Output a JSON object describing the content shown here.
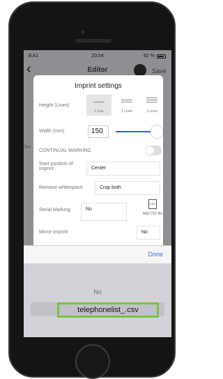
{
  "status": {
    "carrier": "ıll A1",
    "time": "20:54",
    "battery": "82 %"
  },
  "nav": {
    "title": "Editor",
    "save": "Save",
    "back_icon": "chevron-left-icon",
    "side_tab": "Set"
  },
  "dialog": {
    "title": "Imprint settings",
    "height_label": "Height (Lines)",
    "height_options": [
      "1 Line",
      "2 Lines",
      "3 Lines"
    ],
    "width_label": "Width (mm)",
    "width_value": "150",
    "continual_label": "CONTINUAL MARKING",
    "start_label": "Start position of imprint",
    "start_value": "Center",
    "whitespace_label": "Remove whitespace",
    "whitespace_value": "Crop both",
    "serial_label": "Serial Marking",
    "serial_value": "No",
    "csv_label": "Add CSV file",
    "csv_icon_text": "CSV",
    "mirror_label": "Mirror imprint",
    "mirror_value": "No"
  },
  "picker": {
    "done": "Done",
    "options": [
      "No",
      "telephonelist_.csv"
    ]
  },
  "colors": {
    "accent": "#2c6fe0",
    "highlight": "#7cc242"
  }
}
